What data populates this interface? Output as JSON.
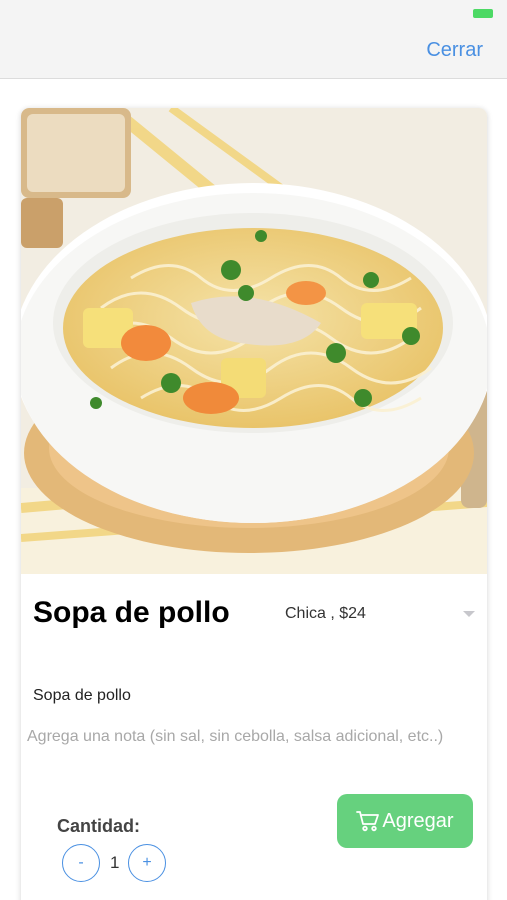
{
  "navbar": {
    "close_label": "Cerrar"
  },
  "product": {
    "title": "Sopa de pollo",
    "description": "Sopa de pollo",
    "size_selected": "Chica , $24",
    "note_placeholder": "Agrega una nota (sin sal, sin cebolla, salsa adicional, etc..)"
  },
  "quantity": {
    "label": "Cantidad:",
    "value": "1",
    "minus_label": "-",
    "plus_label": "+"
  },
  "actions": {
    "add_label": "Agregar"
  },
  "colors": {
    "accent": "#4a90e2",
    "add_button": "#66d17e"
  },
  "icons": {
    "cart": "shopping-cart-icon",
    "dropdown": "chevron-down-icon"
  }
}
